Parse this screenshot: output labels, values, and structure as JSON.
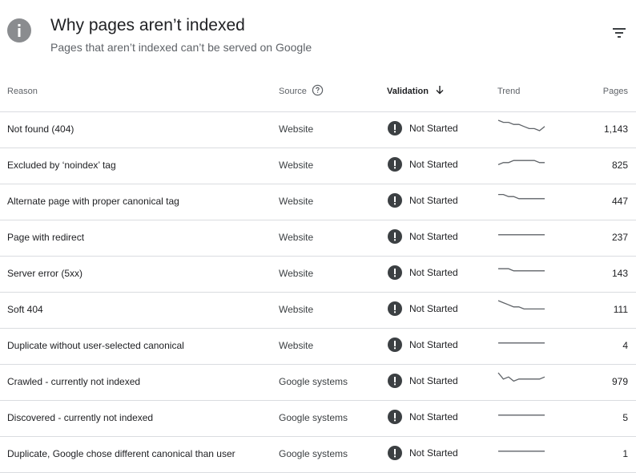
{
  "header": {
    "title": "Why pages aren’t indexed",
    "subtitle": "Pages that aren’t indexed can’t be served on Google"
  },
  "table": {
    "columns": {
      "reason": "Reason",
      "source": "Source",
      "validation": "Validation",
      "trend": "Trend",
      "pages": "Pages"
    },
    "rows": [
      {
        "reason": "Not found (404)",
        "source": "Website",
        "validation": "Not Started",
        "pages": "1,143",
        "trend": [
          0,
          1,
          1,
          2,
          2,
          3,
          4,
          4,
          5,
          3
        ]
      },
      {
        "reason": "Excluded by ‘noindex’ tag",
        "source": "Website",
        "validation": "Not Started",
        "pages": "825",
        "trend": [
          4,
          3,
          3,
          2,
          2,
          2,
          2,
          2,
          3,
          3
        ]
      },
      {
        "reason": "Alternate page with proper canonical tag",
        "source": "Website",
        "validation": "Not Started",
        "pages": "447",
        "trend": [
          1,
          1,
          2,
          2,
          3,
          3,
          3,
          3,
          3,
          3
        ]
      },
      {
        "reason": "Page with redirect",
        "source": "Website",
        "validation": "Not Started",
        "pages": "237",
        "trend": [
          3,
          3,
          3,
          3,
          3,
          3,
          3,
          3,
          3,
          3
        ]
      },
      {
        "reason": "Server error (5xx)",
        "source": "Website",
        "validation": "Not Started",
        "pages": "143",
        "trend": [
          2,
          2,
          2,
          3,
          3,
          3,
          3,
          3,
          3,
          3
        ]
      },
      {
        "reason": "Soft 404",
        "source": "Website",
        "validation": "Not Started",
        "pages": "111",
        "trend": [
          0,
          1,
          2,
          3,
          3,
          4,
          4,
          4,
          4,
          4
        ]
      },
      {
        "reason": "Duplicate without user-selected canonical",
        "source": "Website",
        "validation": "Not Started",
        "pages": "4",
        "trend": [
          3,
          3,
          3,
          3,
          3,
          3,
          3,
          3,
          3,
          3
        ]
      },
      {
        "reason": "Crawled - currently not indexed",
        "source": "Google systems",
        "validation": "Not Started",
        "pages": "979",
        "trend": [
          0,
          3,
          2,
          4,
          3,
          3,
          3,
          3,
          3,
          2
        ]
      },
      {
        "reason": "Discovered - currently not indexed",
        "source": "Google systems",
        "validation": "Not Started",
        "pages": "5",
        "trend": [
          3,
          3,
          3,
          3,
          3,
          3,
          3,
          3,
          3,
          3
        ]
      },
      {
        "reason": "Duplicate, Google chose different canonical than user",
        "source": "Google systems",
        "validation": "Not Started",
        "pages": "1",
        "trend": [
          3,
          3,
          3,
          3,
          3,
          3,
          3,
          3,
          3,
          3
        ]
      }
    ]
  },
  "colors": {
    "status_icon": "#3c4043",
    "divider": "#dadce0",
    "trend_line": "#5f6368"
  }
}
